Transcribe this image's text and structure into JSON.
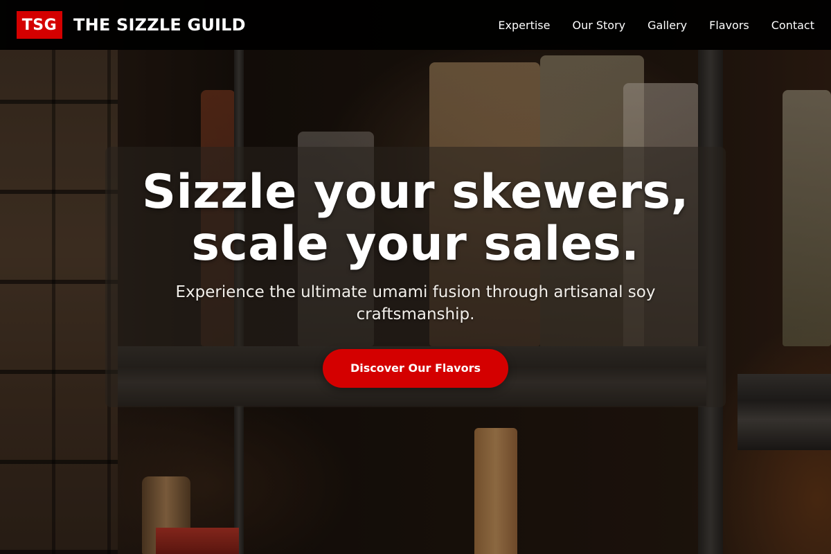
{
  "header": {
    "logo_text": "TSG",
    "brand_name": "THE SIZZLE GUILD",
    "nav": [
      {
        "label": "Expertise"
      },
      {
        "label": "Our Story"
      },
      {
        "label": "Gallery"
      },
      {
        "label": "Flavors"
      },
      {
        "label": "Contact"
      }
    ]
  },
  "hero": {
    "title_line1": "Sizzle your skewers,",
    "title_line2": "scale your sales.",
    "subtitle": "Experience the ultimate umami fusion through artisanal soy craftsmanship.",
    "cta_label": "Discover Our Flavors",
    "background_image": "pantry-shelf-photo"
  },
  "colors": {
    "accent": "#d40000",
    "header_bg": "#000000",
    "text": "#ffffff"
  }
}
